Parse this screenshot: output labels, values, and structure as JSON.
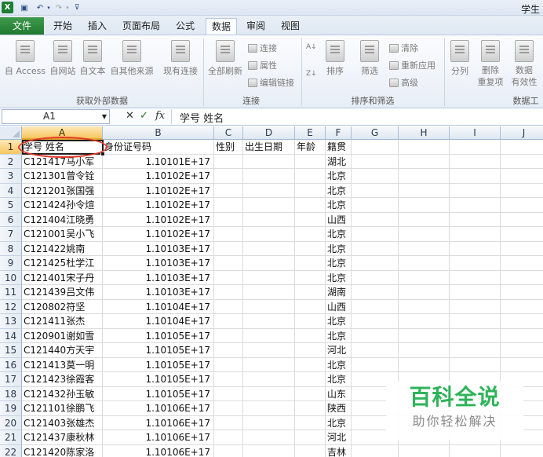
{
  "window": {
    "title": "学生",
    "app_icon": "X"
  },
  "quick_access": {
    "save_icon": "▣",
    "undo_icon": "↶",
    "redo_icon": "↷",
    "dropdown": "▾",
    "customize": "⊽"
  },
  "tabs": {
    "file": "文件",
    "home": "开始",
    "insert": "插入",
    "layout": "页面布局",
    "formula": "公式",
    "data": "数据",
    "review": "审阅",
    "view": "视图"
  },
  "ribbon": {
    "get_external": {
      "from_access": "自 Access",
      "from_web": "自网站",
      "from_text": "自文本",
      "from_other": "自其他来源",
      "existing": "现有连接",
      "group_label": "获取外部数据"
    },
    "connections": {
      "refresh_all": "全部刷新",
      "connections": "连接",
      "properties": "属性",
      "edit_links": "编辑链接",
      "group_label": "连接"
    },
    "sort_filter": {
      "sort": "排序",
      "filter": "筛选",
      "clear": "清除",
      "reapply": "重新应用",
      "advanced": "高级",
      "group_label": "排序和筛选"
    },
    "data_tools": {
      "split": "分列",
      "remove_dup_1": "删除",
      "remove_dup_2": "重复项",
      "validate_1": "数据",
      "validate_2": "有效性",
      "group_label": "数据工"
    }
  },
  "formula_bar": {
    "name_box": "A1",
    "cancel": "✕",
    "enter": "✓",
    "insert_fn": "fx",
    "value": "学号    姓名"
  },
  "columns": [
    "A",
    "B",
    "C",
    "D",
    "E",
    "F",
    "G",
    "H",
    "I",
    "J"
  ],
  "header_row": {
    "a": "学号    姓名",
    "b": "身份证号码",
    "c": "性别",
    "d": "出生日期",
    "e": "年龄",
    "f": "籍贯"
  },
  "rows": [
    {
      "num": "1"
    },
    {
      "num": "2",
      "a": "C121417马小军",
      "b": "1.10101E+17",
      "f": "湖北"
    },
    {
      "num": "3",
      "a": "C121301曾令铨",
      "b": "1.10102E+17",
      "f": "北京"
    },
    {
      "num": "4",
      "a": "C121201张国强",
      "b": "1.10102E+17",
      "f": "北京"
    },
    {
      "num": "5",
      "a": "C121424孙令煊",
      "b": "1.10102E+17",
      "f": "北京"
    },
    {
      "num": "6",
      "a": "C121404江晓勇",
      "b": "1.10102E+17",
      "f": "山西"
    },
    {
      "num": "7",
      "a": "C121001吴小飞",
      "b": "1.10102E+17",
      "f": "北京"
    },
    {
      "num": "8",
      "a": "C121422姚南",
      "b": "1.10103E+17",
      "f": "北京"
    },
    {
      "num": "9",
      "a": "C121425杜学江",
      "b": "1.10103E+17",
      "f": "北京"
    },
    {
      "num": "10",
      "a": "C121401宋子丹",
      "b": "1.10103E+17",
      "f": "北京"
    },
    {
      "num": "11",
      "a": "C121439吕文伟",
      "b": "1.10103E+17",
      "f": "湖南"
    },
    {
      "num": "12",
      "a": "C120802符坚",
      "b": "1.10104E+17",
      "f": "山西"
    },
    {
      "num": "13",
      "a": "C121411张杰",
      "b": "1.10104E+17",
      "f": "北京"
    },
    {
      "num": "14",
      "a": "C120901谢如雪",
      "b": "1.10105E+17",
      "f": "北京"
    },
    {
      "num": "15",
      "a": "C121440方天宇",
      "b": "1.10105E+17",
      "f": "河北"
    },
    {
      "num": "16",
      "a": "C121413莫一明",
      "b": "1.10105E+17",
      "f": "北京"
    },
    {
      "num": "17",
      "a": "C121423徐霞客",
      "b": "1.10105E+17",
      "f": "北京"
    },
    {
      "num": "18",
      "a": "C121432孙玉敏",
      "b": "1.10105E+17",
      "f": "山东"
    },
    {
      "num": "19",
      "a": "C121101徐鹏飞",
      "b": "1.10106E+17",
      "f": "陕西"
    },
    {
      "num": "20",
      "a": "C121403张雄杰",
      "b": "1.10106E+17",
      "f": "北京"
    },
    {
      "num": "21",
      "a": "C121437康秋林",
      "b": "1.10106E+17",
      "f": "河北"
    },
    {
      "num": "22",
      "a": "C121420陈家洛",
      "b": "1.10106E+17",
      "f": "吉林"
    }
  ],
  "watermark": {
    "title": "百科全说",
    "subtitle": "助你轻松解决"
  },
  "colors": {
    "file_tab": "#2a8a3c",
    "selection_highlight": "#f6c65f",
    "annotation_circle": "#e53a2a",
    "watermark_green": "#2fb35a"
  }
}
